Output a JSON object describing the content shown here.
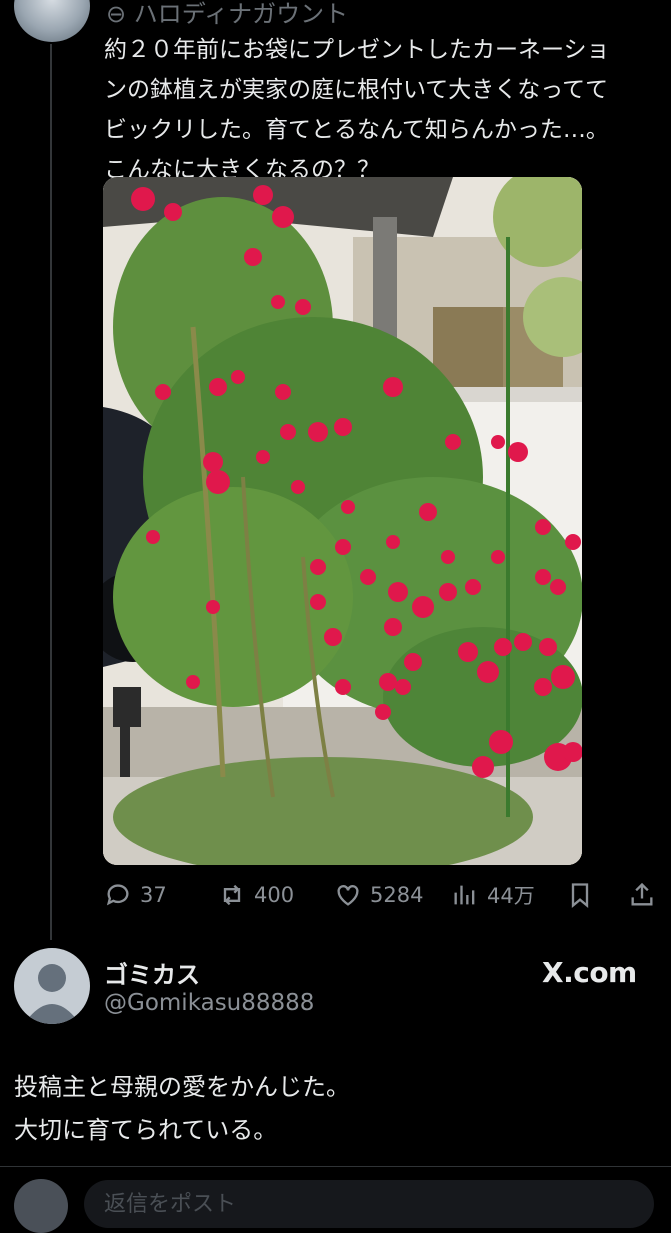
{
  "post": {
    "author_cut": "ハロディナガウント",
    "lines": [
      "約２０年前にお袋にプレゼントしたカーネーショ",
      "ンの鉢植えが実家の庭に根付いて大きくなってて",
      "ビックリした。育てとるなんて知らんかった…。",
      "こんなに大きくなるの？？"
    ],
    "actions": {
      "replies": "37",
      "reposts": "400",
      "likes": "5284",
      "views": "44万"
    }
  },
  "reply_post": {
    "name": "ゴミカス",
    "handle": "@Gomikasu88888",
    "source": "X.com",
    "lines": [
      "投稿主と母親の愛をかんじた。",
      "大切に育てられている。"
    ]
  },
  "composer": {
    "placeholder": "返信をポスト"
  },
  "colors": {
    "background": "#000000",
    "text": "#e7e9ea",
    "muted": "#8b9096",
    "flower": "#e0184c"
  }
}
